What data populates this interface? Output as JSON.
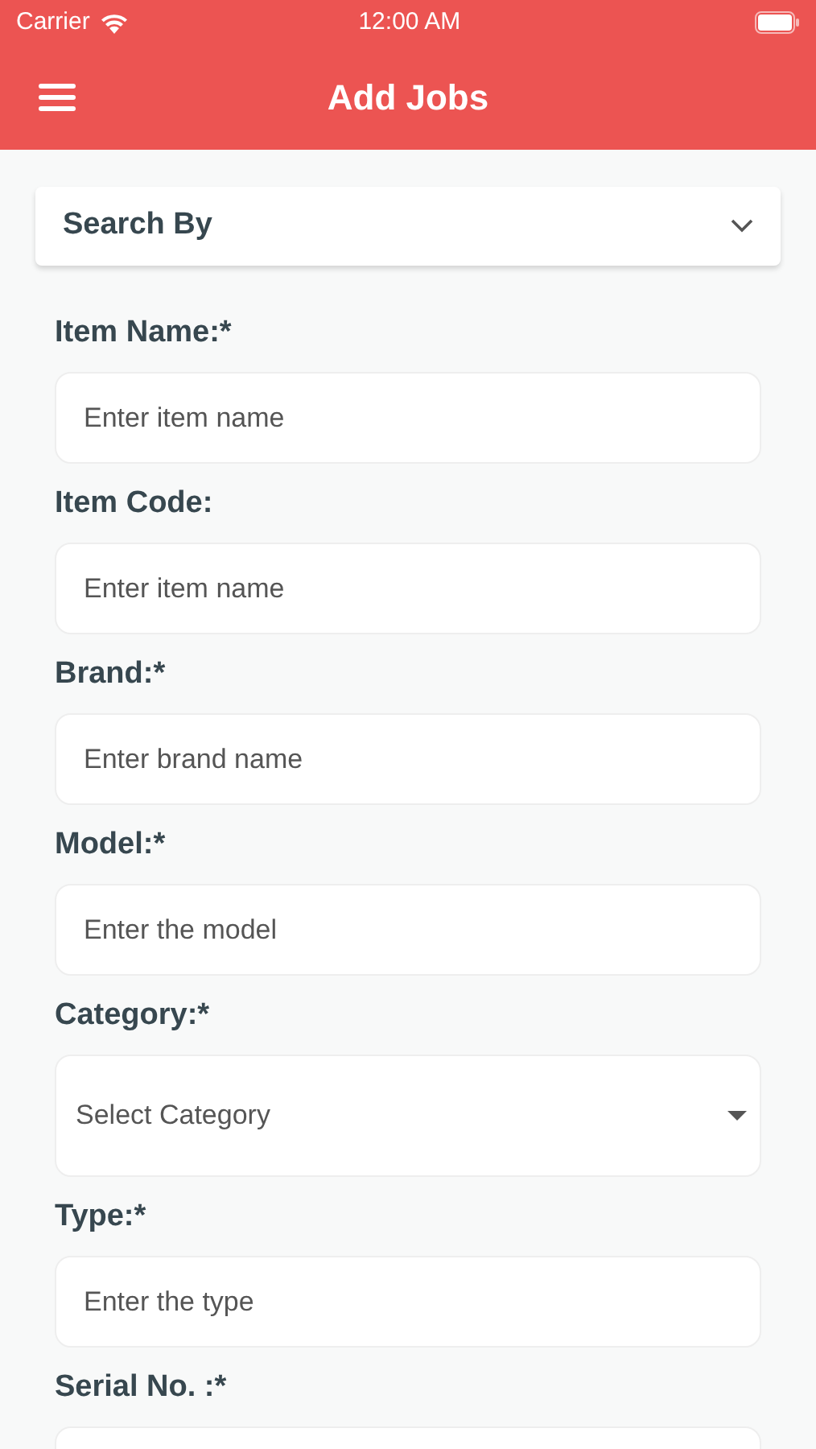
{
  "status_bar": {
    "carrier": "Carrier",
    "time": "12:00 AM"
  },
  "app_bar": {
    "title": "Add Jobs"
  },
  "search_by": {
    "label": "Search By",
    "expanded": false
  },
  "fields": [
    {
      "label": "Item Name:*",
      "kind": "text",
      "placeholder": "Enter item name"
    },
    {
      "label": "Item Code:",
      "kind": "text",
      "placeholder": "Enter item name"
    },
    {
      "label": "Brand:*",
      "kind": "text",
      "placeholder": "Enter brand name"
    },
    {
      "label": "Model:*",
      "kind": "text",
      "placeholder": "Enter the model"
    },
    {
      "label": "Category:*",
      "kind": "select",
      "placeholder": "Select Category"
    },
    {
      "label": "Type:*",
      "kind": "text",
      "placeholder": "Enter the type"
    },
    {
      "label": "Serial No. :*",
      "kind": "text"
    }
  ]
}
